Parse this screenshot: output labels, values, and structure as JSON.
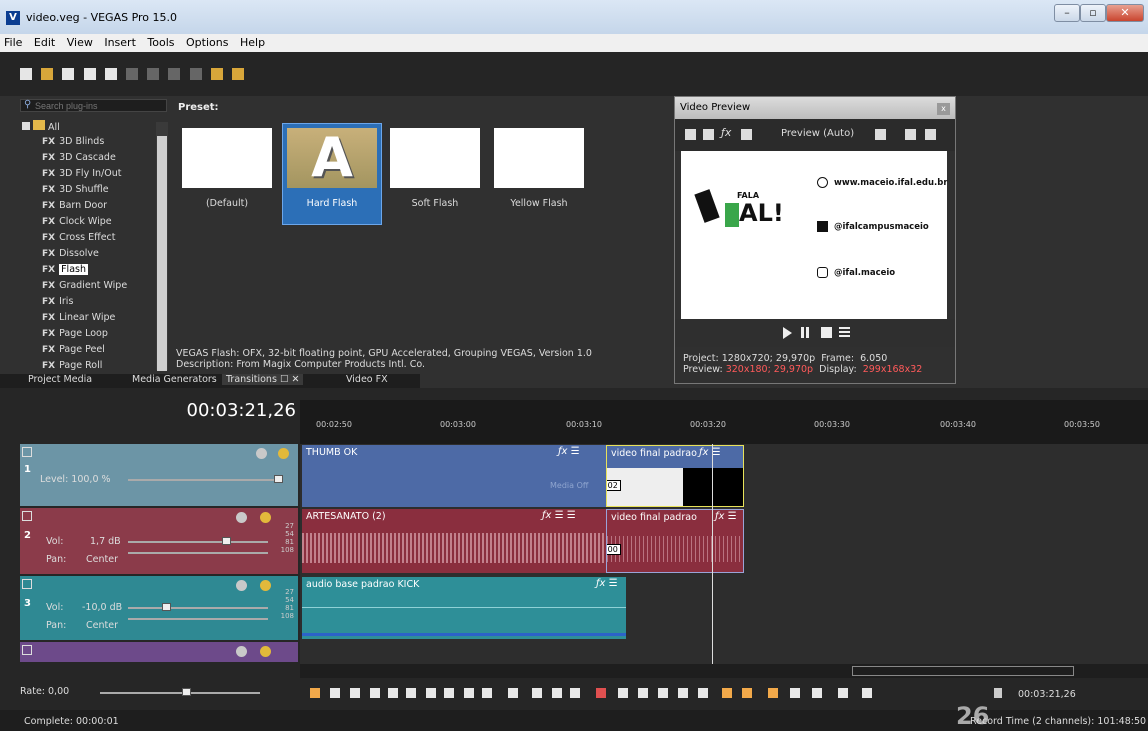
{
  "window": {
    "title": "video.veg - VEGAS Pro 15.0",
    "app_icon_letter": "V",
    "minimize": "–",
    "maximize": "▫",
    "close": "✕"
  },
  "menu": [
    "File",
    "Edit",
    "View",
    "Insert",
    "Tools",
    "Options",
    "Help"
  ],
  "plugins": {
    "search_placeholder": "Search plug-ins",
    "preset_label": "Preset:",
    "tree_root": "All",
    "fx_badge": "FX",
    "items": [
      "3D Blinds",
      "3D Cascade",
      "3D Fly In/Out",
      "3D Shuffle",
      "Barn Door",
      "Clock Wipe",
      "Cross Effect",
      "Dissolve",
      "Flash",
      "Gradient Wipe",
      "Iris",
      "Linear Wipe",
      "Page Loop",
      "Page Peel",
      "Page Roll"
    ],
    "selected_item": "Flash",
    "presets": [
      "(Default)",
      "Hard Flash",
      "Soft Flash",
      "Yellow Flash"
    ],
    "selected_preset": "Hard Flash",
    "hard_flash_letter": "A",
    "description_line1": "VEGAS Flash: OFX, 32-bit floating point, GPU Accelerated, Grouping VEGAS, Version 1.0",
    "description_line2": "Description: From Magix Computer Products Intl. Co."
  },
  "tabs": {
    "project_media": "Project Media",
    "media_generators": "Media Generators",
    "transitions": "Transitions",
    "video_fx": "Video FX"
  },
  "preview": {
    "title": "Video Preview",
    "close": "x",
    "mode": "Preview (Auto)",
    "logo_top": "FALA",
    "logo_main": "AL!",
    "website": "www.maceio.ifal.edu.br",
    "facebook": "@ifalcampusmaceio",
    "instagram": "@ifal.maceio",
    "project_label": "Project:",
    "project_value": "1280x720; 29,970p",
    "frame_label": "Frame:",
    "frame_value": "6.050",
    "preview_label": "Preview:",
    "preview_value": "320x180; 29,970p",
    "display_label": "Display:",
    "display_value": "299x168x32"
  },
  "timeline": {
    "timecode": "00:03:21,26",
    "ruler": [
      "00:02:50",
      "00:03:00",
      "00:03:10",
      "00:03:20",
      "00:03:30",
      "00:03:40",
      "00:03:50"
    ],
    "tracks": [
      {
        "num": "1",
        "level_label": "Level: 100,0 %"
      },
      {
        "num": "2",
        "vol_label": "Vol:",
        "vol_value": "1,7 dB",
        "pan_label": "Pan:",
        "pan_value": "Center"
      },
      {
        "num": "3",
        "vol_label": "Vol:",
        "vol_value": "-10,0 dB",
        "pan_label": "Pan:",
        "pan_value": "Center"
      }
    ],
    "meter_ticks": [
      "27",
      "54",
      "81",
      "108"
    ],
    "clips": {
      "thumb": "THUMB OK",
      "video_final": "video final padrao",
      "artesanato": "ARTESANATO (2)",
      "video_final_audio": "video final padrao",
      "audio_base": "audio base padrao KICK",
      "media_offline": "Media Off",
      "video_badge": "0.02",
      "audio_badge": "0.00"
    },
    "rate": "Rate: 0,00",
    "transport_time": "00:03:21,26"
  },
  "status": {
    "left": "Complete: 00:00:01",
    "right": "Record Time (2 channels): 101:48:50",
    "overlay_number": "26"
  },
  "colors": {
    "video_track": "#4d6aa6",
    "audio_track_red": "#8a2e3e",
    "audio_track_teal": "#2e8f98",
    "track_head_blue": "#6c95a6",
    "track_head_red": "#8b3b4a",
    "track_head_teal": "#2f8993",
    "track_head_purple": "#6d4a8a",
    "selected_blue": "#2c6fb7"
  }
}
